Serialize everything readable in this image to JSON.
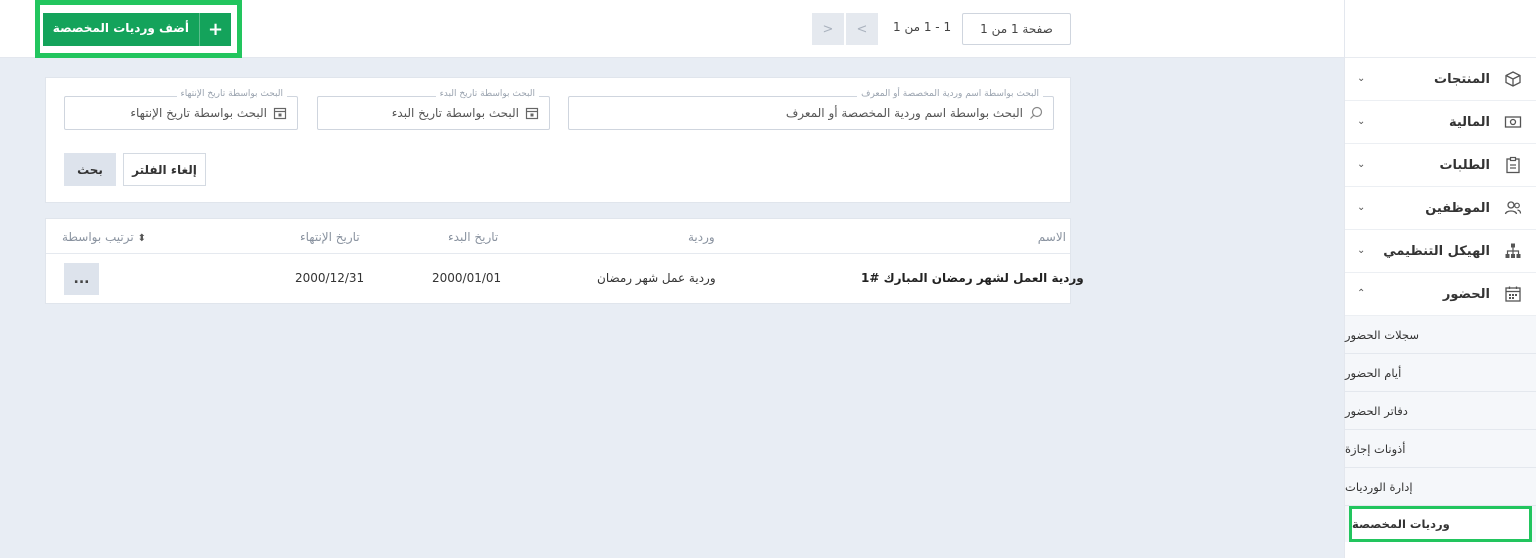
{
  "topbar": {
    "add_button_label": "أضف ورديات المخصصة",
    "add_button_icon": "+",
    "pager_page": "صفحة 1 من 1",
    "pager_range": "1 - 1 من 1",
    "prev_glyph": "<",
    "next_glyph": ">"
  },
  "filters": {
    "name_legend": "البحث بواسطة اسم وردية المخصصة أو المعرف",
    "name_value": "البحث بواسطة اسم وردية المخصصة أو المعرف",
    "start_legend": "البحث بواسطة تاريخ البدء",
    "start_value": "البحث بواسطة تاريخ البدء",
    "end_legend": "البحث بواسطة تاريخ الإنتهاء",
    "end_value": "البحث بواسطة تاريخ الإنتهاء",
    "clear_label": "إلغاء الفلتر",
    "search_label": "بحث"
  },
  "table": {
    "headers": {
      "name": "الاسم",
      "shift": "وردية",
      "start": "تاريخ البدء",
      "end": "تاريخ الإنتهاء",
      "sort": "ترتيب بواسطة"
    },
    "rows": [
      {
        "name": "وردية العمل لشهر رمضان المبارك #1",
        "shift": "وردية عمل شهر رمضان",
        "start": "2000/01/01",
        "end": "2000/12/31",
        "more": "..."
      }
    ]
  },
  "sidebar": {
    "items": [
      {
        "label": "المنتجات",
        "icon": "box-icon",
        "chevron": "⌄"
      },
      {
        "label": "المالية",
        "icon": "money-icon",
        "chevron": "⌄"
      },
      {
        "label": "الطلبات",
        "icon": "clipboard-icon",
        "chevron": "⌄"
      },
      {
        "label": "الموظفين",
        "icon": "users-icon",
        "chevron": "⌄"
      },
      {
        "label": "الهيكل التنظيمي",
        "icon": "org-chart-icon",
        "chevron": "⌄"
      },
      {
        "label": "الحضور",
        "icon": "calendar-icon",
        "chevron": "⌃"
      }
    ],
    "sub_items": [
      {
        "label": "سجلات الحضور"
      },
      {
        "label": "أيام الحضور"
      },
      {
        "label": "دفاتر الحضور"
      },
      {
        "label": "أذونات إجازة"
      },
      {
        "label": "إدارة الورديات"
      },
      {
        "label": "ورديات المخصصة"
      }
    ]
  },
  "colors": {
    "accent_green": "#14a35b",
    "highlight_green": "#22c55e",
    "background": "#e8edf4"
  }
}
